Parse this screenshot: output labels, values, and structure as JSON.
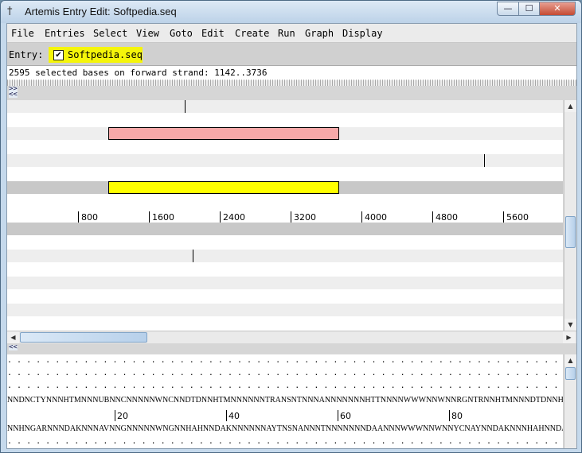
{
  "window": {
    "title": "Artemis Entry Edit: Softpedia.seq",
    "min_glyph": "—",
    "max_glyph": "☐",
    "close_glyph": "✕"
  },
  "menu": [
    "File",
    "Entries",
    "Select",
    "View",
    "Goto",
    "Edit",
    "Create",
    "Run",
    "Graph",
    "Display"
  ],
  "entry": {
    "label": "Entry:",
    "name": "Softpedia.seq",
    "checked": true,
    "check_glyph": "✔",
    "color": "#f5f50a"
  },
  "selection_info": "2595 selected bases on forward strand: 1142..3736",
  "zoom_arrows": {
    "top": ">>\n<<",
    "bottom": "<<"
  },
  "ruler_labels": [
    "800",
    "1600",
    "2400",
    "3200",
    "4000",
    "4800",
    "5600"
  ],
  "features": [
    {
      "kind": "selection",
      "color": "#f7a8a8"
    },
    {
      "kind": "selection",
      "color": "#ffff00"
    }
  ],
  "sequence": {
    "forward": "NNDNCTYNNNHTMNNNUBNNCNNNNNWNCNNDTDNNHTMNNNNNNTRANSNTNNNANNNNNNNHTTNNNNWWWNNWNNRGNTRNNHTMNNNDTDNNHTMNNN",
    "reverse": "NNHNGARNNNDAKNNNAVNNGNNNNNWNGNNHAHNNDAKNNNNNNAYTNSNANNNTNNNNNNNDAANNNWWWNNWNNYCNAYNNDAKNNNHAHNNDAKNNN",
    "ruler_labels": [
      "20",
      "40",
      "60",
      "80"
    ],
    "dots": ". . . . . . . . . . . . . . . . . . . . . . . . . . . . . . . . . . . . . . . . . . . . . . . . . . . . . . . . . . . . . . . . . . . . . . . ."
  },
  "scroll": {
    "up_glyph": "▲",
    "down_glyph": "▼",
    "left_glyph": "◀",
    "right_glyph": "▶"
  },
  "icons": {
    "title": "bug-icon",
    "check": "check-icon"
  }
}
